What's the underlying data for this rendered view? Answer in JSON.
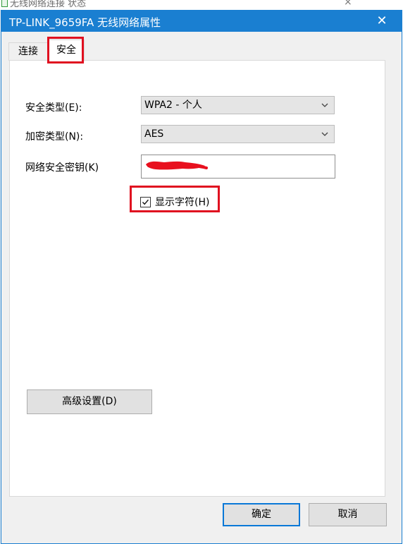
{
  "background_window": {
    "title": "无线网络连接 状态",
    "close_glyph": "×"
  },
  "dialog": {
    "title": "TP-LINK_9659FA 无线网络属性",
    "close_glyph": "✕"
  },
  "tabs": [
    {
      "label": "连接",
      "selected": false
    },
    {
      "label": "安全",
      "selected": true
    }
  ],
  "security": {
    "security_type": {
      "label": "安全类型(E):",
      "value": "WPA2 - 个人"
    },
    "encryption_type": {
      "label": "加密类型(N):",
      "value": "AES"
    },
    "network_key": {
      "label": "网络安全密钥(K)",
      "value_redacted": true
    },
    "show_characters": {
      "label": "显示字符(H)",
      "checked": true
    },
    "advanced_button": "高级设置(D)"
  },
  "footer": {
    "ok": "确定",
    "cancel": "取消"
  },
  "colors": {
    "titlebar": "#1a7fd1",
    "annotation": "#e01020",
    "redaction": "#e8101e",
    "default_button_border": "#0a78d7"
  },
  "icons": {
    "dropdown": "chevron-down-icon",
    "check": "checkmark-icon",
    "close": "close-icon"
  }
}
